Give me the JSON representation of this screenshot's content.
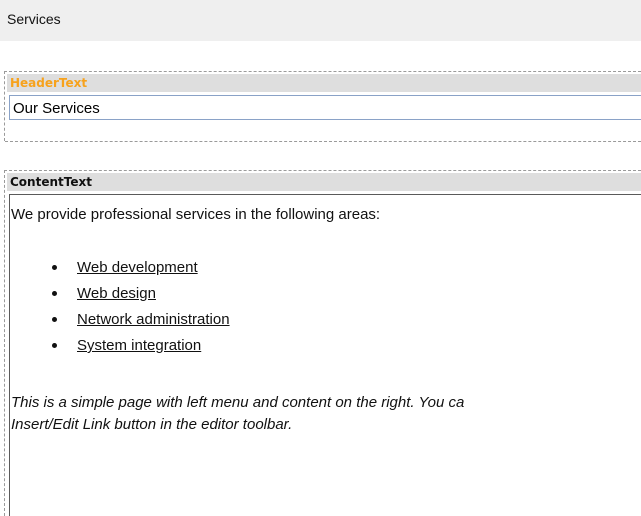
{
  "page": {
    "title": "Services"
  },
  "header_region": {
    "label": "HeaderText",
    "value": "Our Services",
    "label_color": "#f7a21c"
  },
  "content_region": {
    "label": "ContentText",
    "intro": "We provide professional services in the following areas:",
    "links": [
      "Web development",
      "Web design",
      "Network administration",
      "System integration"
    ],
    "note_line1": "This is a simple page with left menu and content on the right. You ca",
    "note_line2": "Insert/Edit Link button in the editor toolbar."
  }
}
